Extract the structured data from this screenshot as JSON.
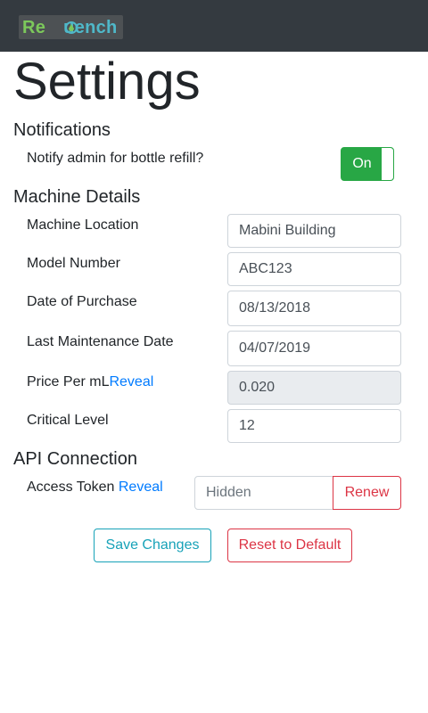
{
  "brand": {
    "text_part1": "Re",
    "text_part2": "uench",
    "colors": {
      "green": "#7cc85b",
      "teal": "#4fb8c9"
    }
  },
  "page_title": "Settings",
  "notifications": {
    "title": "Notifications",
    "refill_label": "Notify admin for bottle refill?",
    "toggle_label": "On",
    "toggle_state": true
  },
  "machine": {
    "title": "Machine Details",
    "location_label": "Machine Location",
    "location_value": "Mabini Building",
    "model_label": "Model Number",
    "model_value": "ABC123",
    "purchase_label": "Date of Purchase",
    "purchase_value": "08/13/2018",
    "maintenance_label": "Last Maintenance Date",
    "maintenance_value": "04/07/2019",
    "price_label": "Price Per mL",
    "price_reveal": "Reveal",
    "price_value": "0.020",
    "critical_label": "Critical Level",
    "critical_value": "12"
  },
  "api": {
    "title": "API Connection",
    "token_label": "Access Token",
    "token_reveal": "Reveal",
    "token_placeholder": "Hidden",
    "renew_label": "Renew"
  },
  "actions": {
    "save_label": "Save Changes",
    "reset_label": "Reset to Default"
  },
  "colors": {
    "navbar": "#343a40",
    "success": "#28a745",
    "info": "#17a2b8",
    "danger": "#dc3545",
    "link": "#007bff"
  }
}
